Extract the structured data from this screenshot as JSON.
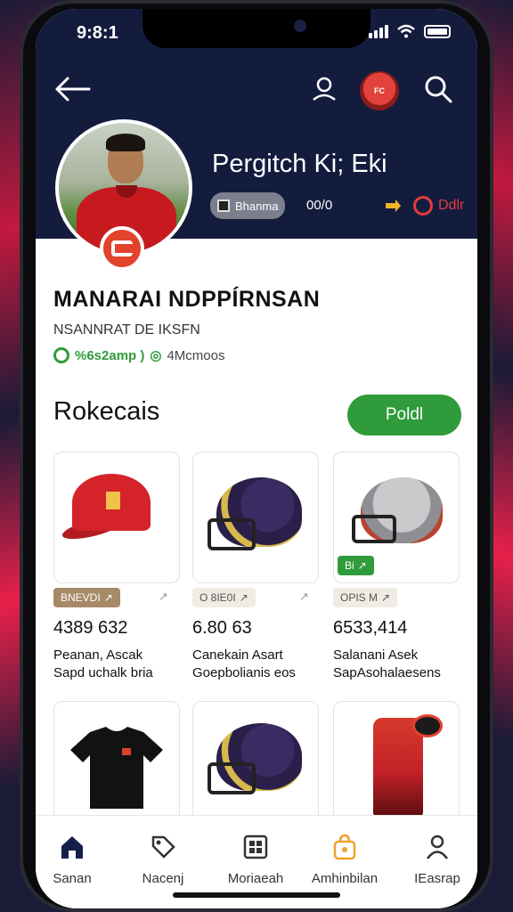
{
  "status_bar": {
    "time": "9:8:1"
  },
  "header": {
    "badge_text": "FC",
    "player_name": "Pergitch Ki; Eki",
    "pill_label": "Bhanma",
    "pill_value": "00/0",
    "follow_label": "Ddlr",
    "accent": "#e53b3b"
  },
  "store": {
    "title": "MANARAI NDPPÍRNSAN",
    "subtitle": "NSANNRAT DE IKSFN",
    "meta_a": "%6s2amp )",
    "meta_b": "◎",
    "meta_c": "4Mcmoos"
  },
  "section": {
    "title": "Rokecais",
    "cta_label": "Poldl",
    "cta_color": "#2f9b3a"
  },
  "products": [
    {
      "tag": "BNEVDI",
      "price": "4389 632",
      "name_line1": "Peanan, Ascak",
      "name_line2": "Sapd uchalk bria",
      "icon": "cap-icon"
    },
    {
      "tag": "O 8IE0I",
      "price": "6.80 63",
      "name_line1": "Canekain Asart",
      "name_line2": "Goepbolianis eos",
      "icon": "helmet-icon"
    },
    {
      "tag": "OPIS M",
      "price": "6533,414",
      "name_line1": "Salanani Asek",
      "name_line2": "SapAsohalaesens",
      "icon": "helmet-icon",
      "overlay_tag": "Bi"
    },
    {
      "icon": "tshirt-icon"
    },
    {
      "icon": "helmet-icon"
    },
    {
      "icon": "jersey-icon"
    }
  ],
  "bottom_nav": [
    {
      "label": "Sanan",
      "icon": "home-icon"
    },
    {
      "label": "Nacenj",
      "icon": "tag-icon"
    },
    {
      "label": "Moriaeah",
      "icon": "grid-icon"
    },
    {
      "label": "Amhinbilan",
      "icon": "bag-icon"
    },
    {
      "label": "IEasrap",
      "icon": "person-icon"
    }
  ]
}
